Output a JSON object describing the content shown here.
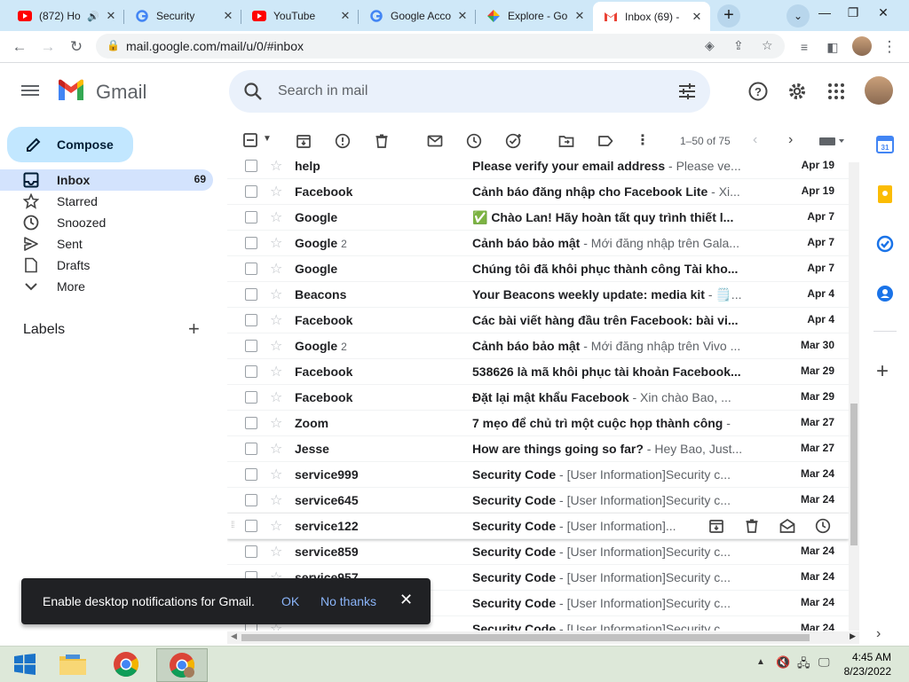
{
  "browser": {
    "tabs": [
      {
        "title": "(872) Ho",
        "icon": "youtube-icon",
        "audio": true
      },
      {
        "title": "Security",
        "icon": "google-icon"
      },
      {
        "title": "YouTube",
        "icon": "youtube-icon"
      },
      {
        "title": "Google Acco",
        "icon": "google-icon"
      },
      {
        "title": "Explore - Go",
        "icon": "photos-icon"
      },
      {
        "title": "Inbox (69) -",
        "icon": "gmail-icon",
        "active": true
      }
    ],
    "url": "mail.google.com/mail/u/0/#inbox"
  },
  "gmail": {
    "brand": "Gmail",
    "search_placeholder": "Search in mail",
    "compose_label": "Compose",
    "nav": [
      {
        "label": "Inbox",
        "count": "69",
        "icon": "inbox-icon",
        "selected": true
      },
      {
        "label": "Starred",
        "icon": "star-icon"
      },
      {
        "label": "Snoozed",
        "icon": "clock-icon"
      },
      {
        "label": "Sent",
        "icon": "send-icon"
      },
      {
        "label": "Drafts",
        "icon": "draft-icon"
      },
      {
        "label": "More",
        "icon": "chevron-down-icon"
      }
    ],
    "labels_title": "Labels",
    "page_info": "1–50 of 75",
    "emails": [
      {
        "sender": "help",
        "count": "",
        "subject": "Please verify your email address",
        "snippet": " - Please ve...",
        "date": "Apr 19"
      },
      {
        "sender": "Facebook",
        "count": "",
        "subject": "Cảnh báo đăng nhập cho Facebook Lite",
        "snippet": " - Xi...",
        "date": "Apr 19"
      },
      {
        "sender": "Google",
        "count": "",
        "subject": "✅ Chào Lan! Hãy hoàn tất quy trình thiết l...",
        "snippet": "",
        "date": "Apr 7"
      },
      {
        "sender": "Google",
        "count": "2",
        "subject": "Cảnh báo bảo mật",
        "snippet": " - Mới đăng nhập trên Gala...",
        "date": "Apr 7"
      },
      {
        "sender": "Google",
        "count": "",
        "subject": "Chúng tôi đã khôi phục thành công Tài kho...",
        "snippet": "",
        "date": "Apr 7"
      },
      {
        "sender": "Beacons",
        "count": "",
        "subject": "Your Beacons weekly update: media kit",
        "snippet": " - 🗒️...",
        "date": "Apr 4"
      },
      {
        "sender": "Facebook",
        "count": "",
        "subject": "Các bài viết hàng đầu trên Facebook: bài vi...",
        "snippet": "",
        "date": "Apr 4"
      },
      {
        "sender": "Google",
        "count": "2",
        "subject": "Cảnh báo bảo mật",
        "snippet": " - Mới đăng nhập trên Vivo ...",
        "date": "Mar 30"
      },
      {
        "sender": "Facebook",
        "count": "",
        "subject": "538626 là mã khôi phục tài khoản Facebook...",
        "snippet": "",
        "date": "Mar 29"
      },
      {
        "sender": "Facebook",
        "count": "",
        "subject": "Đặt lại mật khẩu Facebook",
        "snippet": " - Xin chào Bao, ...",
        "date": "Mar 29"
      },
      {
        "sender": "Zoom",
        "count": "",
        "subject": "7 mẹo để chủ trì một cuộc họp thành công",
        "snippet": " - ",
        "date": "Mar 27"
      },
      {
        "sender": "Jesse",
        "count": "",
        "subject": "How are things going so far?",
        "snippet": " - Hey Bao, Just...",
        "date": "Mar 27"
      },
      {
        "sender": "service999",
        "count": "",
        "subject": "Security Code",
        "snippet": " - [User Information]Security c...",
        "date": "Mar 24"
      },
      {
        "sender": "service645",
        "count": "",
        "subject": "Security Code",
        "snippet": " - [User Information]Security c...",
        "date": "Mar 24"
      },
      {
        "sender": "service122",
        "count": "",
        "subject": "Security Code",
        "snippet": " - [User Information]...",
        "date": "",
        "hover": true
      },
      {
        "sender": "service859",
        "count": "",
        "subject": "Security Code",
        "snippet": " - [User Information]Security c...",
        "date": "Mar 24"
      },
      {
        "sender": "service957",
        "count": "",
        "subject": "Security Code",
        "snippet": " - [User Information]Security c...",
        "date": "Mar 24"
      },
      {
        "sender": "",
        "count": "",
        "subject": "Security Code",
        "snippet": " - [User Information]Security c...",
        "date": "Mar 24"
      },
      {
        "sender": "",
        "count": "",
        "subject": "Security Code",
        "snippet": " - [User Information]Security c...",
        "date": "Mar 24"
      }
    ]
  },
  "toast": {
    "message": "Enable desktop notifications for Gmail.",
    "ok": "OK",
    "no_thanks": "No thanks"
  },
  "taskbar": {
    "time": "4:45 AM",
    "date": "8/23/2022"
  },
  "colors": {
    "tabstrip": "#cfe8f8",
    "compose": "#c2e7ff",
    "selected_nav": "#d3e3fd",
    "search_bg": "#eaf1fb",
    "toast_link": "#8ab4f8"
  }
}
